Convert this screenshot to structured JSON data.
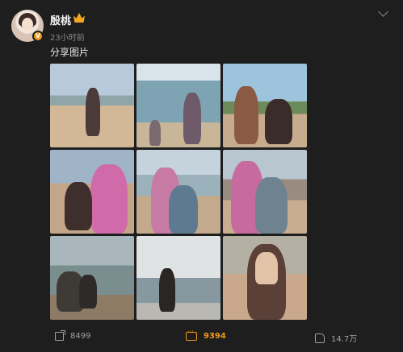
{
  "user": {
    "name": "殷桃",
    "timestamp": "23小时前",
    "verified_badge": "V"
  },
  "post": {
    "text": "分享图片",
    "images": [
      {
        "icon": "beach-photo-1"
      },
      {
        "icon": "beach-photo-2"
      },
      {
        "icon": "beach-photo-3"
      },
      {
        "icon": "beach-photo-4"
      },
      {
        "icon": "beach-photo-5"
      },
      {
        "icon": "beach-photo-6"
      },
      {
        "icon": "beach-photo-7"
      },
      {
        "icon": "beach-photo-8"
      },
      {
        "icon": "beach-photo-9"
      }
    ]
  },
  "footer": {
    "reposts": "8499",
    "comments": "9394",
    "likes": "14.7万"
  },
  "colors": {
    "background": "#1e1e1e",
    "accent": "#f39a1b",
    "muted_text": "#8a8a8a"
  }
}
